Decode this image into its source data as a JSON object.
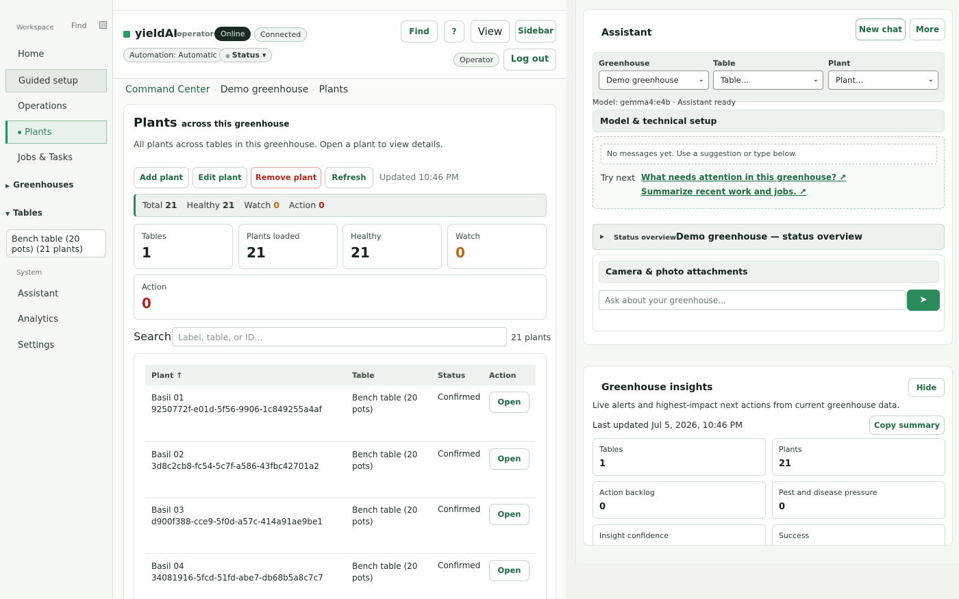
{
  "sidebar": {
    "workspace_label": "Workspace",
    "find_label": "Find",
    "items": [
      {
        "label": "Home"
      },
      {
        "label": "Guided setup"
      },
      {
        "label": "Operations"
      },
      {
        "label": "Plants"
      },
      {
        "label": "Jobs & Tasks"
      }
    ],
    "greenhouses_label": "Greenhouses",
    "tables_label": "Tables",
    "bench_label": "Bench table (20 pots) (21 plants)",
    "system_label": "System",
    "system_items": [
      {
        "label": "Assistant"
      },
      {
        "label": "Analytics"
      },
      {
        "label": "Settings"
      }
    ]
  },
  "header": {
    "app_name": "yieldAI",
    "role": "operator",
    "online": "Online",
    "connected": "Connected",
    "automation": "Automation: Automatic",
    "status": "Status ▾",
    "find": "Find",
    "help": "?",
    "view": "View",
    "sidebar": "Sidebar",
    "operator_badge": "Operator",
    "logout": "Log out"
  },
  "breadcrumb": {
    "root": "Command Center",
    "greenhouse": "Demo greenhouse",
    "current": "Plants"
  },
  "plants": {
    "title": "Plants",
    "subtitle": "across this greenhouse",
    "description": "All plants across tables in this greenhouse. Open a plant to view details.",
    "buttons": {
      "add": "Add plant",
      "edit": "Edit plant",
      "remove": "Remove plant",
      "refresh": "Refresh"
    },
    "updated": "Updated 10:46 PM",
    "summary": {
      "total_label": "Total",
      "total": "21",
      "healthy_label": "Healthy",
      "healthy": "21",
      "watch_label": "Watch",
      "watch": "0",
      "action_label": "Action",
      "action": "0"
    },
    "cards": {
      "tables": {
        "label": "Tables",
        "value": "1"
      },
      "loaded": {
        "label": "Plants loaded",
        "value": "21"
      },
      "healthy": {
        "label": "Healthy",
        "value": "21"
      },
      "watch": {
        "label": "Watch",
        "value": "0"
      },
      "action": {
        "label": "Action",
        "value": "0"
      }
    },
    "search": {
      "label": "Search",
      "placeholder": "Label, table, or ID…",
      "count": "21 plants"
    },
    "table": {
      "headers": {
        "plant": "Plant ↑",
        "table": "Table",
        "status": "Status",
        "action": "Action"
      },
      "rows": [
        {
          "name": "Basil 01",
          "id": "9250772f-e01d-5f56-9906-1c849255a4af",
          "table": "Bench table (20 pots)",
          "status": "Confirmed",
          "action": "Open"
        },
        {
          "name": "Basil 02",
          "id": "3d8c2cb8-fc54-5c7f-a586-43fbc42701a2",
          "table": "Bench table (20 pots)",
          "status": "Confirmed",
          "action": "Open"
        },
        {
          "name": "Basil 03",
          "id": "d900f388-cce9-5f0d-a57c-414a91ae9be1",
          "table": "Bench table (20 pots)",
          "status": "Confirmed",
          "action": "Open"
        },
        {
          "name": "Basil 04",
          "id": "34081916-5fcd-51fd-abe7-db68b5a8c7c7",
          "table": "Bench table (20 pots)",
          "status": "Confirmed",
          "action": "Open"
        }
      ]
    }
  },
  "assistant": {
    "title": "Assistant",
    "new_chat": "New chat",
    "more": "More",
    "greenhouse_label": "Greenhouse",
    "greenhouse_value": "Demo greenhouse",
    "table_label": "Table",
    "table_value": "Table…",
    "plant_label": "Plant",
    "plant_value": "Plant…",
    "model": "Model: gemma4:e4b · Assistant ready",
    "setup": "Model & technical setup",
    "no_messages": "No messages yet. Use a suggestion or type below.",
    "try_next": "Try next",
    "suggestions": [
      "What needs attention in this greenhouse? ↗",
      "Summarize recent work and jobs. ↗"
    ],
    "status_small": "Status overview",
    "status_title": "Demo greenhouse — status overview",
    "camera": "Camera & photo attachments",
    "ask_placeholder": "Ask about your greenhouse...",
    "send": "➤"
  },
  "insights": {
    "title": "Greenhouse insights",
    "hide": "Hide",
    "description": "Live alerts and highest-impact next actions from current greenhouse data.",
    "updated": "Last updated Jul 5, 2026, 10:46 PM",
    "copy": "Copy summary",
    "cards": [
      {
        "label": "Tables",
        "value": "1"
      },
      {
        "label": "Plants",
        "value": "21"
      },
      {
        "label": "Action backlog",
        "value": "0"
      },
      {
        "label": "Pest and disease pressure",
        "value": "0"
      },
      {
        "label": "Insight confidence",
        "value": ""
      },
      {
        "label": "Success",
        "value": ""
      }
    ]
  }
}
